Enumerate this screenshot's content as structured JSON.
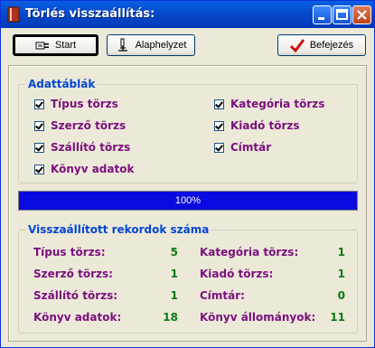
{
  "window": {
    "title": "Törlés visszaállítás:"
  },
  "toolbar": {
    "start_label": "Start",
    "reset_label": "Alaphelyzet",
    "finish_label": "Befejezés"
  },
  "tables_group": {
    "title": "Adattáblák",
    "items": [
      {
        "label": "Típus törzs",
        "checked": true
      },
      {
        "label": "Szerző törzs",
        "checked": true
      },
      {
        "label": "Szállító törzs",
        "checked": true
      },
      {
        "label": "Könyv adatok",
        "checked": true
      },
      {
        "label": "Kategória törzs",
        "checked": true
      },
      {
        "label": "Kiadó törzs",
        "checked": true
      },
      {
        "label": "Címtár",
        "checked": true
      }
    ]
  },
  "progress": {
    "label": "100%",
    "value": 1.0,
    "color": "#0a0ae0"
  },
  "stats_group": {
    "title": "Visszaállított rekordok száma",
    "rows": [
      {
        "label": "Típus törzs:",
        "value": "5"
      },
      {
        "label": "Szerző törzs:",
        "value": "1"
      },
      {
        "label": "Szállító törzs:",
        "value": "1"
      },
      {
        "label": "Könyv adatok:",
        "value": "18"
      },
      {
        "label": "Kategória törzs:",
        "value": "1"
      },
      {
        "label": "Kiadó törzs:",
        "value": "1"
      },
      {
        "label": "Címtár:",
        "value": "0"
      },
      {
        "label": "Könyv állományok:",
        "value": "11"
      }
    ]
  },
  "colors": {
    "label": "#7b0f7e",
    "value": "#0a7a16",
    "group_title": "#0046d5",
    "titlebar": "#0447c7"
  },
  "icons": {
    "start": "plug-icon",
    "reset": "microscope-icon",
    "finish": "checkmark-icon",
    "app": "book-icon"
  }
}
